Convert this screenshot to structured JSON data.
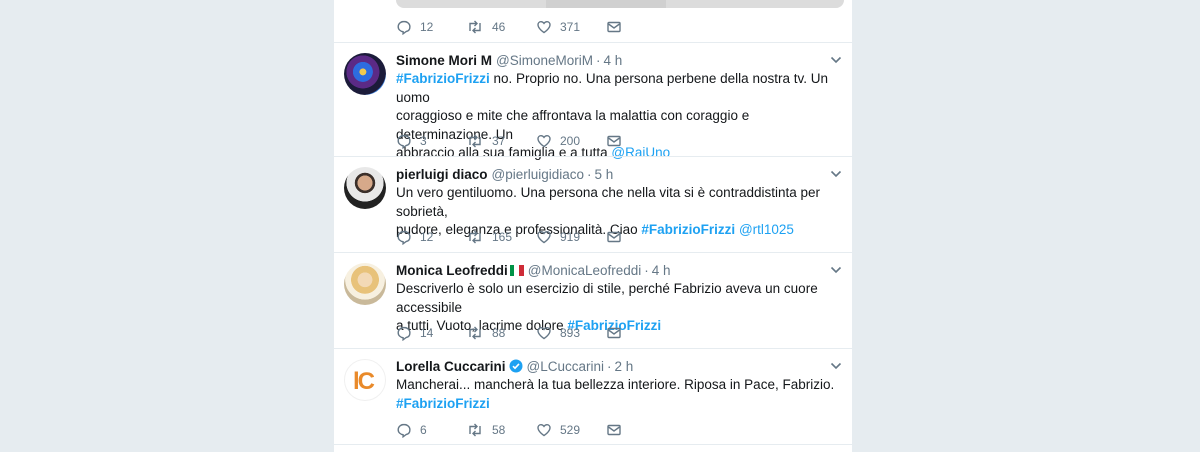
{
  "top_tweet": {
    "replies": "12",
    "retweets": "46",
    "likes": "371"
  },
  "tweets": [
    {
      "name": "Simone Mori M",
      "handle": "@SimoneMoriM",
      "time": "4 h",
      "lines": [
        [
          {
            "t": "#FabrizioFrizzi",
            "k": "hashtag"
          },
          {
            "t": " no. Proprio no. Una persona perbene della nostra tv. Un uomo",
            "k": ""
          }
        ],
        [
          {
            "t": "coraggioso e mite che affrontava la malattia con coraggio e determinazione. Un",
            "k": ""
          }
        ],
        [
          {
            "t": "abbraccio alla sua famiglia e a tutta ",
            "k": ""
          },
          {
            "t": "@RaiUno",
            "k": "mention"
          }
        ]
      ],
      "replies": "3",
      "retweets": "37",
      "likes": "200"
    },
    {
      "name": "pierluigi diaco",
      "handle": "@pierluigidiaco",
      "time": "5 h",
      "lines": [
        [
          {
            "t": "Un vero gentiluomo. Una persona che nella vita si è contraddistinta per sobrietà,",
            "k": ""
          }
        ],
        [
          {
            "t": "pudore, eleganza e professionalità. Ciao ",
            "k": ""
          },
          {
            "t": "#FabrizioFrizzi",
            "k": "hashtag"
          },
          {
            "t": " ",
            "k": ""
          },
          {
            "t": "@rtl1025",
            "k": "mention"
          }
        ]
      ],
      "replies": "12",
      "retweets": "165",
      "likes": "919"
    },
    {
      "name": "Monica Leofreddi",
      "handle": "@MonicaLeofreddi",
      "time": "4 h",
      "lines": [
        [
          {
            "t": "Descriverlo è solo un esercizio di stile, perché Fabrizio aveva un cuore accessibile",
            "k": ""
          }
        ],
        [
          {
            "t": "a tutti. Vuoto, lacrime dolore ",
            "k": ""
          },
          {
            "t": "#FabrizioFrizzi",
            "k": "hashtag"
          }
        ]
      ],
      "replies": "14",
      "retweets": "88",
      "likes": "893"
    },
    {
      "name": "Lorella Cuccarini",
      "handle": "@LCuccarini",
      "time": "2 h",
      "lines": [
        [
          {
            "t": "Mancherai... mancherà la tua bellezza interiore. Riposa in Pace, Fabrizio.",
            "k": ""
          }
        ],
        [
          {
            "t": "#FabrizioFrizzi",
            "k": "hashtag"
          }
        ]
      ],
      "replies": "6",
      "retweets": "58",
      "likes": "529"
    }
  ],
  "colors": {
    "link": "#1da1f2",
    "muted": "#657786",
    "background": "#e6ecf0",
    "verified": "#1da1f2"
  },
  "icons": {
    "reply": "reply-icon",
    "retweet": "retweet-icon",
    "like": "heart-icon",
    "dm": "envelope-icon",
    "caret": "chevron-down-icon",
    "verified": "verified-badge-icon",
    "flag": "italian-flag-icon"
  }
}
